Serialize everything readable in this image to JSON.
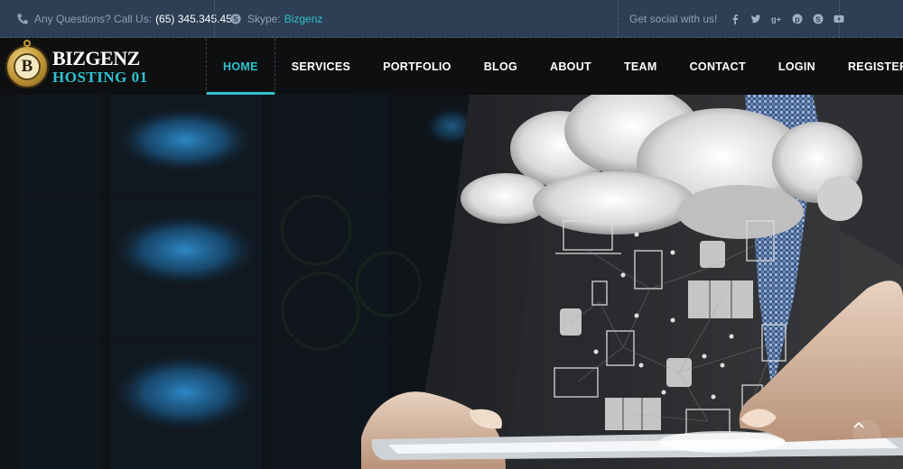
{
  "topbar": {
    "question_label": "Any Questions? Call Us:",
    "phone": "(65) 345.345.45",
    "skype_label": "Skype:",
    "skype_value": "Bizgenz",
    "social_label": "Get social with us!",
    "social_icons": [
      "facebook-icon",
      "twitter-icon",
      "google-plus-icon",
      "pinterest-icon",
      "skype-icon",
      "youtube-icon"
    ]
  },
  "brand": {
    "line1": "BIZGENZ",
    "line2": "HOSTING 01",
    "badge_letter": "B"
  },
  "nav": {
    "items": [
      "HOME",
      "SERVICES",
      "PORTFOLIO",
      "BLOG",
      "ABOUT",
      "TEAM",
      "CONTACT",
      "LOGIN",
      "REGISTER"
    ],
    "active": "HOME"
  },
  "colors": {
    "accent": "#2fc2cf",
    "topbar_bg": "#2e3e54",
    "navbar_bg": "#0e0f11"
  }
}
